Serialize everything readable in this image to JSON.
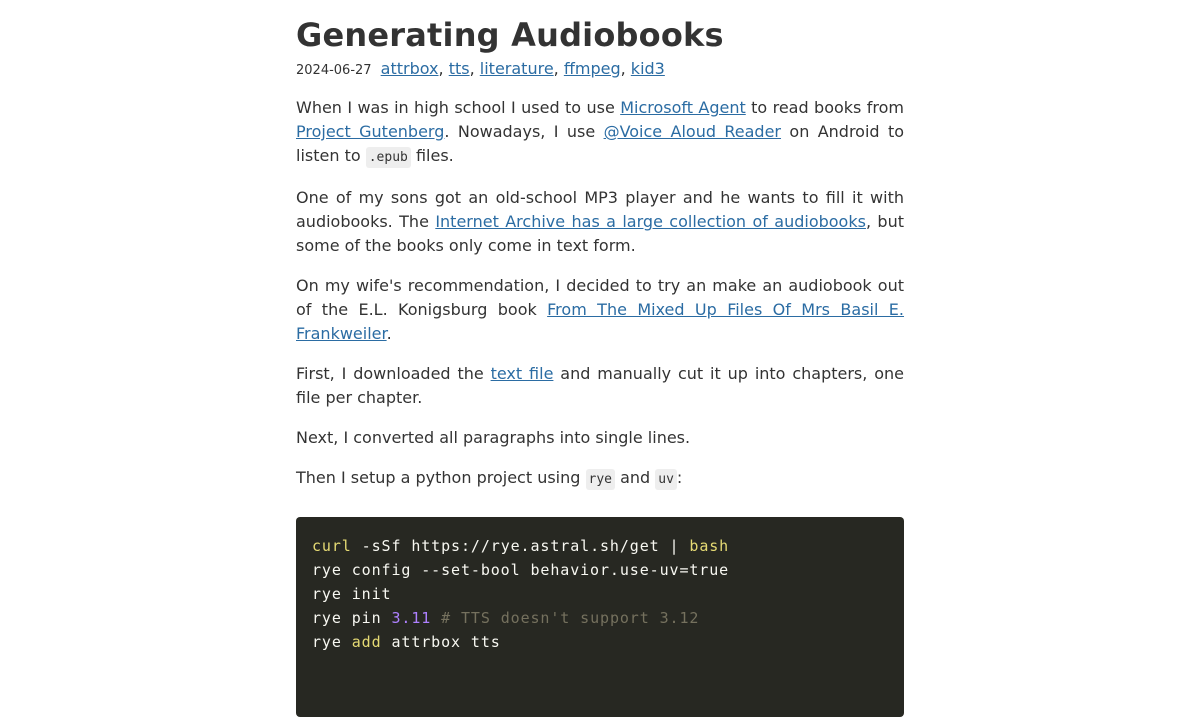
{
  "post": {
    "title": "Generating Audiobooks",
    "date": "2024-06-27",
    "tags": [
      "attrbox",
      "tts",
      "literature",
      "ffmpeg",
      "kid3"
    ],
    "tag_separator": ","
  },
  "paragraphs": {
    "p1": {
      "t1": "When I was in high school I used to use ",
      "l1": "Microsoft Agent",
      "t2": " to read books from ",
      "l2": "Project Gutenberg",
      "t3": ". Nowadays, I use ",
      "l3": "@Voice Aloud Reader",
      "t4": " on Android to listen to ",
      "c1": ".epub",
      "t5": " files."
    },
    "p2": {
      "t1": "One of my sons got an old-school MP3 player and he wants to fill it with audiobooks. The ",
      "l1": "Internet Archive has a large collection of audiobooks",
      "t2": ", but some of the books only come in text form."
    },
    "p3": {
      "t1": "On my wife's recommendation, I decided to try an make an audiobook out of the E.L. Konigsburg book ",
      "l1": "From The Mixed Up Files Of Mrs Basil E. Frankweiler",
      "t2": "."
    },
    "p4": {
      "t1": "First, I downloaded the ",
      "l1": "text file",
      "t2": " and manually cut it up into chapters, one file per chapter."
    },
    "p5": {
      "t1": "Next, I converted all paragraphs into single lines."
    },
    "p6": {
      "t1": "Then I setup a python project using ",
      "c1": "rye",
      "t2": " and ",
      "c2": "uv",
      "t3": ":"
    }
  },
  "code": {
    "line1": {
      "kw": "curl",
      "rest": " -sSf https://rye.astral.sh/get | ",
      "kw2": "bash"
    },
    "line2": {
      "text": "rye config --set-bool behavior.use-uv=true"
    },
    "line3": {
      "text": "rye init"
    },
    "line4": {
      "pre": "rye pin ",
      "num": "3.11",
      "sp": " ",
      "cmt": "# TTS doesn't support 3.12"
    },
    "line5": {
      "pre": "rye ",
      "kw": "add",
      "rest": " attrbox tts"
    }
  },
  "colors": {
    "link": "#2b6ca3",
    "code_bg": "#272822",
    "code_fg": "#f8f8f2",
    "code_keyword": "#e6db74",
    "code_number": "#ae81ff",
    "code_comment": "#75715e",
    "inline_code_bg": "#eeeeee"
  }
}
